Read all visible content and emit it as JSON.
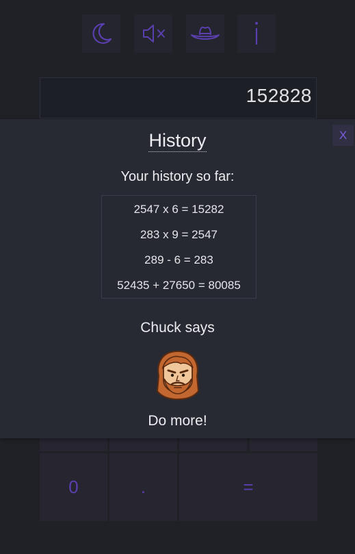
{
  "toolbar": {
    "icons": [
      "moon-icon",
      "speaker-muted-icon",
      "cowboy-hat-icon",
      "info-icon"
    ],
    "accent_color": "#5b3fb0"
  },
  "display": {
    "value": "152828"
  },
  "keypad": {
    "zero": "0",
    "dot": ".",
    "equals": "="
  },
  "history_modal": {
    "close_label": "X",
    "title": "History",
    "subtitle": "Your history so far:",
    "items": [
      "2547 x 6 = 15282",
      "283 x 9 = 2547",
      "289 - 6 = 283",
      "52435 + 27650 = 80085"
    ],
    "chuck_heading": "Chuck says",
    "chuck_icon": "chuck-norris-avatar",
    "chuck_message": "Do more!"
  },
  "colors": {
    "background": "#1f2127",
    "panel": "#272a33",
    "accent": "#5b3fb0"
  }
}
